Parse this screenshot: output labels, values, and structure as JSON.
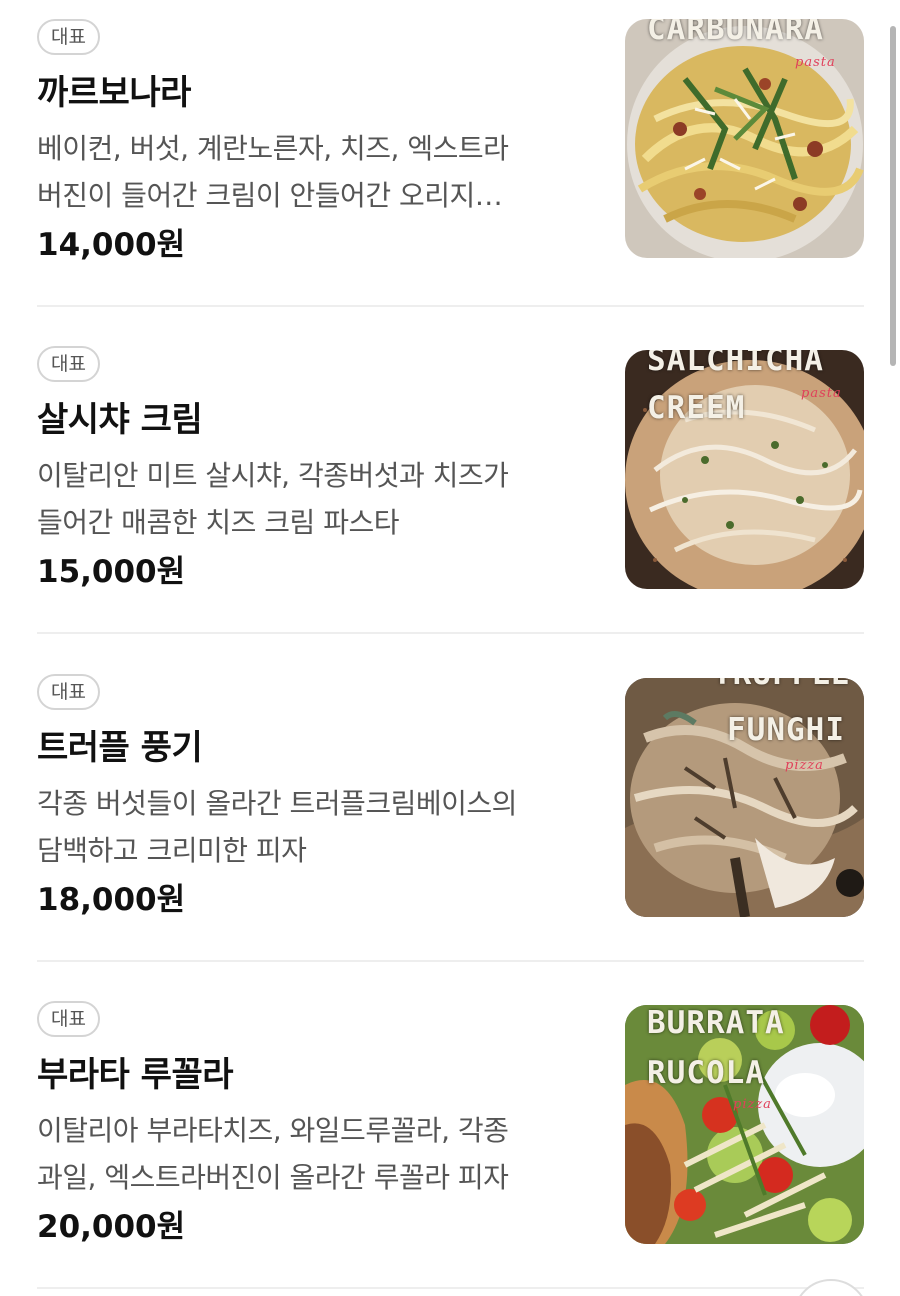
{
  "menu": {
    "items": [
      {
        "badge": "대표",
        "name": "까르보나라",
        "description_lines": [
          "베이컨, 버섯, 계란노른자, 치즈, 엑스트라",
          "버진이 들어간 크림이 안들어간 오리지…"
        ],
        "price": "14,000원",
        "photo": {
          "title_lines": [
            "CARBUNARA"
          ],
          "tag": "pasta",
          "icon": "carbonara-photo"
        }
      },
      {
        "badge": "대표",
        "name": "살시챠 크림",
        "description_lines": [
          "이탈리안 미트 살시챠, 각종버섯과 치즈가",
          "들어간 매콤한 치즈 크림 파스타"
        ],
        "price": "15,000원",
        "photo": {
          "title_lines": [
            "SALCHICHA",
            "CREEM"
          ],
          "tag": "pasta",
          "icon": "salsiccia-cream-photo"
        }
      },
      {
        "badge": "대표",
        "name": "트러플 풍기",
        "description_lines": [
          "각종 버섯들이 올라간 트러플크림베이스의",
          "담백하고 크리미한 피자"
        ],
        "price": "18,000원",
        "photo": {
          "title_lines": [
            "TRUFFLE",
            "FUNGHI"
          ],
          "tag": "pizza",
          "icon": "truffle-funghi-photo"
        }
      },
      {
        "badge": "대표",
        "name": "부라타 루꼴라",
        "description_lines": [
          "이탈리아 부라타치즈, 와일드루꼴라, 각종",
          "과일, 엑스트라버진이 올라간 루꼴라 피자"
        ],
        "price": "20,000원",
        "photo": {
          "title_lines": [
            "BURRATA",
            "RUCOLA"
          ],
          "tag": "pizza",
          "icon": "burrata-rucola-photo"
        }
      }
    ]
  },
  "colors": {
    "text_primary": "#111111",
    "text_secondary": "#555555",
    "badge_border": "#d4d4d4",
    "divider": "#eeeeee",
    "scrollbar": "#b5b5b5"
  }
}
